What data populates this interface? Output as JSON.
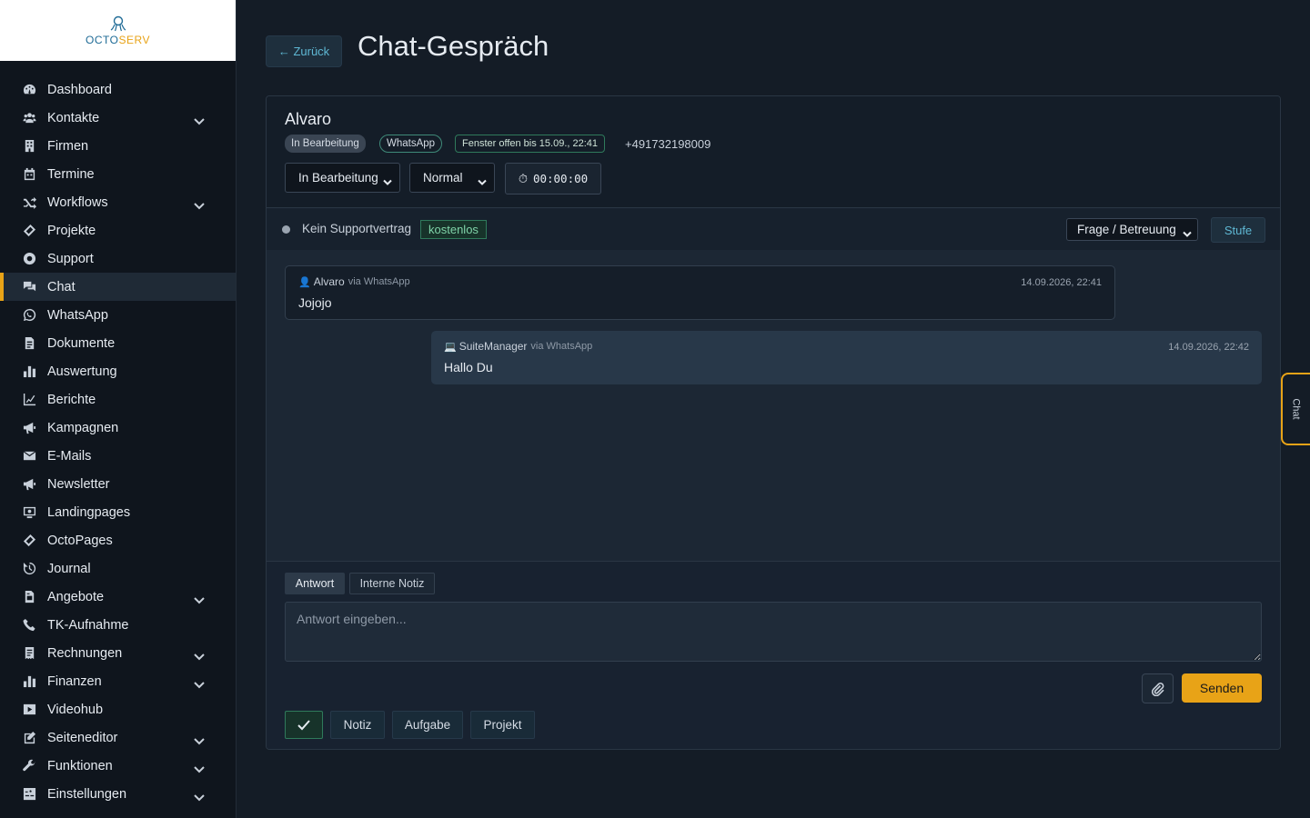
{
  "brand": {
    "name_part1": "OCTO",
    "name_part2": "SERV"
  },
  "sidebar": {
    "items": [
      {
        "label": "Dashboard",
        "icon": "dashboard-icon",
        "expandable": false
      },
      {
        "label": "Kontakte",
        "icon": "users-icon",
        "expandable": true
      },
      {
        "label": "Firmen",
        "icon": "building-icon",
        "expandable": false
      },
      {
        "label": "Termine",
        "icon": "calendar-icon",
        "expandable": false
      },
      {
        "label": "Workflows",
        "icon": "shuffle-icon",
        "expandable": true
      },
      {
        "label": "Projekte",
        "icon": "ticket-icon",
        "expandable": false
      },
      {
        "label": "Support",
        "icon": "lifebuoy-icon",
        "expandable": false
      },
      {
        "label": "Chat",
        "icon": "chat-icon",
        "expandable": false,
        "active": true
      },
      {
        "label": "WhatsApp",
        "icon": "whatsapp-icon",
        "expandable": false
      },
      {
        "label": "Dokumente",
        "icon": "document-icon",
        "expandable": false
      },
      {
        "label": "Auswertung",
        "icon": "bar-chart-icon",
        "expandable": false
      },
      {
        "label": "Berichte",
        "icon": "line-chart-icon",
        "expandable": false
      },
      {
        "label": "Kampagnen",
        "icon": "megaphone-icon",
        "expandable": false
      },
      {
        "label": "E-Mails",
        "icon": "envelope-icon",
        "expandable": false
      },
      {
        "label": "Newsletter",
        "icon": "megaphone-icon",
        "expandable": false
      },
      {
        "label": "Landingpages",
        "icon": "monitor-icon",
        "expandable": false
      },
      {
        "label": "OctoPages",
        "icon": "ticket-icon",
        "expandable": false
      },
      {
        "label": "Journal",
        "icon": "history-icon",
        "expandable": false
      },
      {
        "label": "Angebote",
        "icon": "file-invoice-icon",
        "expandable": true
      },
      {
        "label": "TK-Aufnahme",
        "icon": "phone-icon",
        "expandable": false
      },
      {
        "label": "Rechnungen",
        "icon": "receipt-icon",
        "expandable": true
      },
      {
        "label": "Finanzen",
        "icon": "bar-chart-icon",
        "expandable": true
      },
      {
        "label": "Videohub",
        "icon": "video-icon",
        "expandable": false
      },
      {
        "label": "Seiteneditor",
        "icon": "edit-icon",
        "expandable": true
      },
      {
        "label": "Funktionen",
        "icon": "wrench-icon",
        "expandable": true
      },
      {
        "label": "Einstellungen",
        "icon": "settings-icon",
        "expandable": true
      }
    ]
  },
  "header": {
    "back_label": "← Zurück",
    "title": "Chat-Gespräch"
  },
  "conversation": {
    "contact_name": "Alvaro",
    "status_badge": "In Bearbeitung",
    "channel_badge": "WhatsApp",
    "window_badge": "Fenster offen bis 15.09., 22:41",
    "phone": "+491732198009",
    "status_select": "In Bearbeitung",
    "priority_select": "Normal",
    "timer_icon": "⏱",
    "timer_value": "00:00:00"
  },
  "support": {
    "contract_text": "Kein Supportvertrag",
    "free_badge": "kostenlos",
    "category_select": "Frage / Betreuung",
    "level_button": "Stufe"
  },
  "messages": [
    {
      "icon": "👤",
      "sender": "Alvaro",
      "via": "via WhatsApp",
      "time": "14.09.2026, 22:41",
      "text": "Jojojo"
    },
    {
      "icon": "💻",
      "sender": "SuiteManager",
      "via": "via WhatsApp",
      "time": "14.09.2026, 22:42",
      "text": "Hallo Du"
    }
  ],
  "composer": {
    "tab_reply": "Antwort",
    "tab_internal": "Interne Notiz",
    "placeholder": "Antwort eingeben...",
    "send_label": "Senden",
    "actions": {
      "note": "Notiz",
      "task": "Aufgabe",
      "project": "Projekt"
    }
  },
  "side_tab": {
    "label": "Chat"
  },
  "colors": {
    "accent": "#e8a317",
    "link": "#5fb8d4",
    "success": "#2f7a5b",
    "background": "#141c26"
  }
}
